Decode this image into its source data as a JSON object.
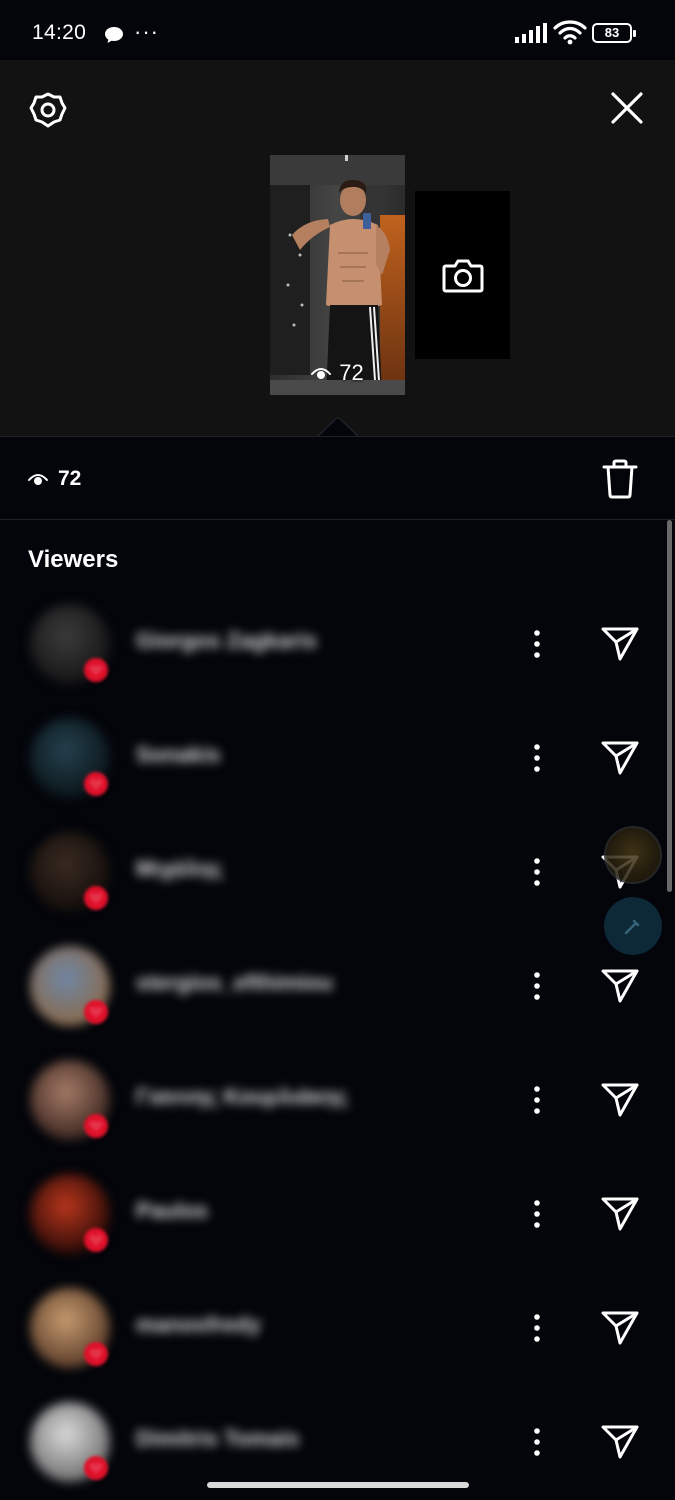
{
  "status_bar": {
    "time": "14:20",
    "more": "···",
    "battery": "83",
    "icons": [
      "chat-bubble-icon",
      "signal-icon",
      "wifi-icon",
      "battery-icon"
    ]
  },
  "header": {
    "settings_icon": "gear-icon",
    "close_icon": "close-icon",
    "add_story_icon": "camera-icon",
    "story_views": "72"
  },
  "summary": {
    "views": "72",
    "delete_icon": "trash-icon"
  },
  "viewers_title": "Viewers",
  "viewers": [
    {
      "name": "Giorgos Zagkaris",
      "avatar_colors": [
        "#3b3b3b",
        "#151515"
      ]
    },
    {
      "name": "Sonakis",
      "avatar_colors": [
        "#24414e",
        "#0b1519"
      ]
    },
    {
      "name": "Μιχάλης",
      "avatar_colors": [
        "#3a2a22",
        "#120d0a"
      ]
    },
    {
      "name": "stergios_efthimiou",
      "avatar_colors": [
        "#6f86a4",
        "#8a6a4c"
      ]
    },
    {
      "name": "Γιαννης Κουρλιάκης",
      "avatar_colors": [
        "#a57a66",
        "#3b2620"
      ]
    },
    {
      "name": "Paulos",
      "avatar_colors": [
        "#b8361c",
        "#2b0a07"
      ]
    },
    {
      "name": "manosfredy",
      "avatar_colors": [
        "#c59a6e",
        "#5b3c2a"
      ]
    },
    {
      "name": "Dimitris Tomais",
      "avatar_colors": [
        "#d9d9d9",
        "#6e6e6e"
      ]
    }
  ],
  "colors": {
    "background": "#03050a",
    "header": "#121212",
    "heart": "#e0102a"
  }
}
